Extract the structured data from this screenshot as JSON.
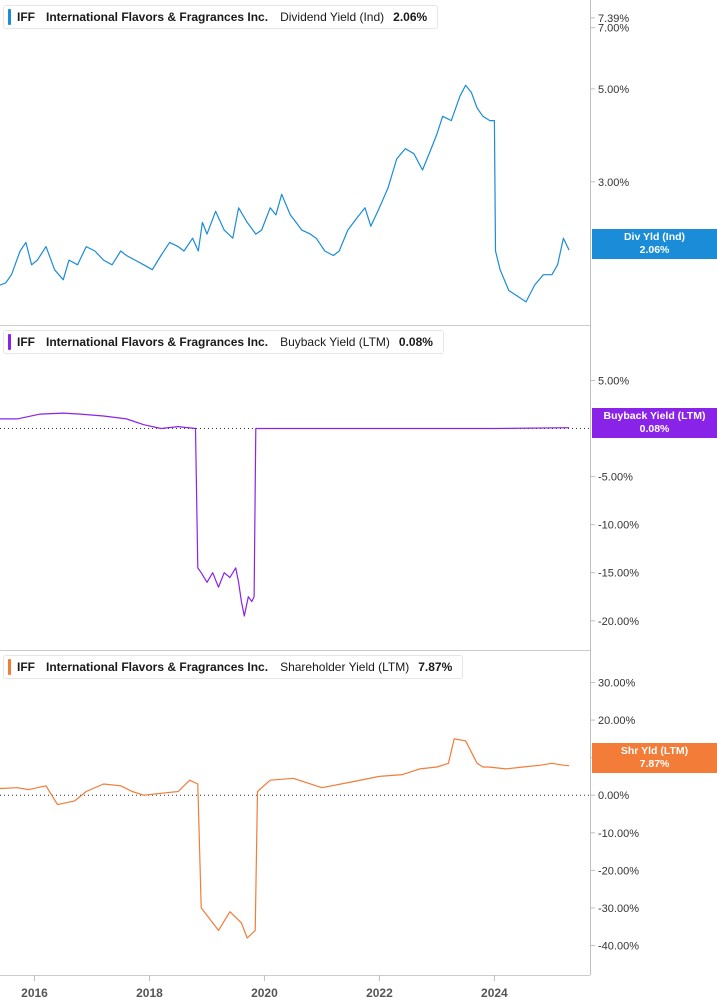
{
  "ticker": "IFF",
  "company": "International Flavors & Fragrances Inc.",
  "x_axis": {
    "tick_labels": [
      "2016",
      "2018",
      "2020",
      "2022",
      "2024"
    ]
  },
  "chart_data": [
    {
      "type": "line",
      "id": "dividend",
      "metric": "Dividend Yield (Ind)",
      "current_value": "2.06%",
      "tag_line1": "Div Yld (Ind)",
      "tag_line2": "2.06%",
      "color": "#1a8cd8",
      "scale": "log",
      "ylim": [
        1.45,
        7.8
      ],
      "y_ticks": [
        "7.39%",
        "7.00%",
        "5.00%",
        "3.00%"
      ],
      "y_tick_values": [
        7.39,
        7.0,
        5.0,
        3.0
      ],
      "series": [
        {
          "x": [
            2015.4,
            2015.5,
            2015.6,
            2015.75,
            2015.85,
            2015.95,
            2016.05,
            2016.2,
            2016.35,
            2016.5,
            2016.6,
            2016.75,
            2016.9,
            2017.05,
            2017.2,
            2017.35,
            2017.5,
            2017.6,
            2017.75,
            2017.9,
            2018.05,
            2018.2,
            2018.35,
            2018.5,
            2018.6,
            2018.75,
            2018.85,
            2018.92,
            2019.0,
            2019.15,
            2019.3,
            2019.45,
            2019.55,
            2019.7,
            2019.85,
            2019.95,
            2020.1,
            2020.2,
            2020.3,
            2020.45,
            2020.55,
            2020.65,
            2020.8,
            2020.9,
            2021.05,
            2021.2,
            2021.3,
            2021.45,
            2021.6,
            2021.75,
            2021.85,
            2022.0,
            2022.15,
            2022.3,
            2022.45,
            2022.6,
            2022.75,
            2022.9,
            2023.0,
            2023.1,
            2023.25,
            2023.4,
            2023.5,
            2023.6,
            2023.7,
            2023.8,
            2023.92,
            2024.0,
            2024.02,
            2024.1,
            2024.25,
            2024.4,
            2024.55,
            2024.7,
            2024.85,
            2025.0,
            2025.1,
            2025.2,
            2025.3
          ],
          "y": [
            1.7,
            1.72,
            1.8,
            2.05,
            2.15,
            1.9,
            1.95,
            2.1,
            1.85,
            1.75,
            1.95,
            1.9,
            2.1,
            2.05,
            1.95,
            1.9,
            2.05,
            2.0,
            1.95,
            1.9,
            1.85,
            2.0,
            2.15,
            2.1,
            2.05,
            2.2,
            2.05,
            2.4,
            2.25,
            2.55,
            2.3,
            2.2,
            2.6,
            2.4,
            2.25,
            2.3,
            2.6,
            2.5,
            2.8,
            2.5,
            2.4,
            2.3,
            2.25,
            2.2,
            2.05,
            2.0,
            2.05,
            2.3,
            2.45,
            2.6,
            2.35,
            2.6,
            2.9,
            3.4,
            3.6,
            3.5,
            3.2,
            3.6,
            3.9,
            4.3,
            4.2,
            4.8,
            5.1,
            4.9,
            4.5,
            4.3,
            4.2,
            4.2,
            2.05,
            1.85,
            1.65,
            1.6,
            1.55,
            1.7,
            1.8,
            1.8,
            1.9,
            2.2,
            2.06
          ]
        }
      ]
    },
    {
      "type": "line",
      "id": "buyback",
      "metric": "Buyback Yield (LTM)",
      "current_value": "0.08%",
      "tag_line1": "Buyback Yield (LTM)",
      "tag_line2": "0.08%",
      "color": "#8a23e8",
      "scale": "linear",
      "ylim": [
        -22,
        9
      ],
      "y_ticks": [
        "5.00%",
        "-5.00%",
        "-10.00%",
        "-15.00%",
        "-20.00%"
      ],
      "y_tick_values": [
        5,
        -5,
        -10,
        -15,
        -20
      ],
      "zero_line": true,
      "series": [
        {
          "x": [
            2015.4,
            2015.7,
            2016.1,
            2016.5,
            2016.8,
            2017.2,
            2017.6,
            2017.9,
            2018.2,
            2018.5,
            2018.8,
            2018.84,
            2018.9,
            2019.0,
            2019.1,
            2019.2,
            2019.3,
            2019.4,
            2019.5,
            2019.55,
            2019.6,
            2019.65,
            2019.72,
            2019.78,
            2019.82,
            2019.85,
            2020.3,
            2021.0,
            2022.0,
            2023.0,
            2024.0,
            2025.3
          ],
          "y": [
            1.0,
            1.0,
            1.5,
            1.6,
            1.5,
            1.3,
            1.0,
            0.4,
            0.0,
            0.2,
            0.0,
            -14.5,
            -15.0,
            -16.0,
            -15.0,
            -16.5,
            -15.0,
            -15.5,
            -14.5,
            -16.0,
            -18.0,
            -19.5,
            -17.5,
            -18.0,
            -17.5,
            0.0,
            0.0,
            0.0,
            0.0,
            0.0,
            0.0,
            0.08
          ]
        }
      ]
    },
    {
      "type": "line",
      "id": "shareholder",
      "metric": "Shareholder Yield (LTM)",
      "current_value": "7.87%",
      "tag_line1": "Shr Yld (LTM)",
      "tag_line2": "7.87%",
      "color": "#f27c38",
      "scale": "linear",
      "ylim": [
        -46,
        36
      ],
      "y_ticks": [
        "30.00%",
        "20.00%",
        "10.00%",
        "0.00%",
        "-10.00%",
        "-20.00%",
        "-30.00%",
        "-40.00%"
      ],
      "y_tick_values": [
        30,
        20,
        10,
        0,
        -10,
        -20,
        -30,
        -40
      ],
      "zero_line": true,
      "series": [
        {
          "x": [
            2015.4,
            2015.7,
            2015.9,
            2016.2,
            2016.4,
            2016.7,
            2016.9,
            2017.2,
            2017.5,
            2017.7,
            2017.9,
            2018.2,
            2018.5,
            2018.7,
            2018.84,
            2018.9,
            2019.0,
            2019.2,
            2019.4,
            2019.6,
            2019.7,
            2019.84,
            2019.88,
            2020.1,
            2020.5,
            2021.0,
            2021.5,
            2022.0,
            2022.4,
            2022.7,
            2023.0,
            2023.2,
            2023.3,
            2023.5,
            2023.7,
            2023.8,
            2023.9,
            2024.2,
            2024.5,
            2024.8,
            2025.0,
            2025.2,
            2025.3
          ],
          "y": [
            1.8,
            2.0,
            1.5,
            2.5,
            -2.5,
            -1.5,
            1.0,
            3.0,
            2.5,
            1.0,
            0.0,
            0.5,
            1.0,
            4.0,
            3.0,
            -30.0,
            -32.0,
            -36.0,
            -31.0,
            -34.0,
            -38.0,
            -36.0,
            1.0,
            4.0,
            4.5,
            2.0,
            3.5,
            5.0,
            5.5,
            7.0,
            7.5,
            8.5,
            15.0,
            14.5,
            8.5,
            7.5,
            7.5,
            7.0,
            7.5,
            8.0,
            8.5,
            8.0,
            7.87
          ]
        }
      ]
    }
  ]
}
